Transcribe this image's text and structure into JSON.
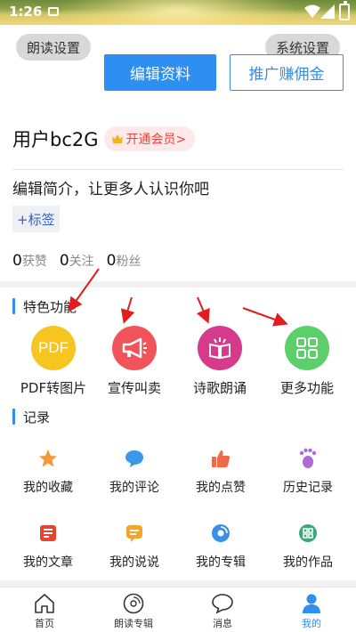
{
  "status_bar": {
    "time": "1:26"
  },
  "header": {
    "reading_settings": "朗读设置",
    "system_settings": "系统设置",
    "edit_profile": "编辑资料",
    "promote": "推广赚佣金"
  },
  "profile": {
    "username": "用户bc2G",
    "vip_label": "开通会员>",
    "bio_prompt": "编辑简介，让更多人认识你吧",
    "add_tag": "+标签",
    "stats": [
      {
        "count": "0",
        "label": "获赞"
      },
      {
        "count": "0",
        "label": "关注"
      },
      {
        "count": "0",
        "label": "粉丝"
      }
    ]
  },
  "features": {
    "title": "特色功能",
    "items": [
      {
        "icon": "pdf-icon",
        "label": "PDF转图片",
        "color": "#f6c51f",
        "glyph": "PDF"
      },
      {
        "icon": "megaphone-icon",
        "label": "宣传叫卖",
        "color": "#f0545a",
        "glyph": ""
      },
      {
        "icon": "poem-book-icon",
        "label": "诗歌朗诵",
        "color": "#d63a8a",
        "glyph": ""
      },
      {
        "icon": "grid-apps-icon",
        "label": "更多功能",
        "color": "#5ccf6b",
        "glyph": ""
      }
    ]
  },
  "records": {
    "title": "记录",
    "items": [
      {
        "icon": "star-icon",
        "label": "我的收藏",
        "color": "#f59a3b"
      },
      {
        "icon": "comment-icon",
        "label": "我的评论",
        "color": "#3b98e8"
      },
      {
        "icon": "thumbs-up-icon",
        "label": "我的点赞",
        "color": "#ef6a4b"
      },
      {
        "icon": "footprint-icon",
        "label": "历史记录",
        "color": "#b06ad8"
      },
      {
        "icon": "article-icon",
        "label": "我的文章",
        "color": "#e4452f"
      },
      {
        "icon": "talk-icon",
        "label": "我的说说",
        "color": "#f4a32b"
      },
      {
        "icon": "album-icon",
        "label": "我的专辑",
        "color": "#3a8fe6"
      },
      {
        "icon": "works-icon",
        "label": "我的作品",
        "color": "#3aa87a"
      }
    ]
  },
  "tabbar": {
    "items": [
      {
        "icon": "home-icon",
        "label": "首页"
      },
      {
        "icon": "vinyl-album-icon",
        "label": "朗读专辑"
      },
      {
        "icon": "chat-bubble-icon",
        "label": "消息"
      },
      {
        "icon": "person-icon",
        "label": "我的"
      }
    ],
    "active_index": 3,
    "accent": "#2f8ef2"
  },
  "annotation_color": "#e11d1d"
}
